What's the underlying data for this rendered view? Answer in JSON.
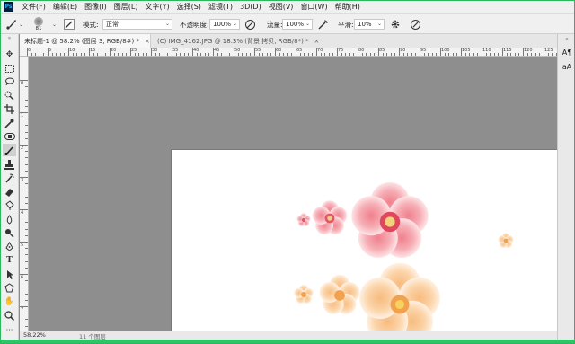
{
  "app": {
    "logo": "Ps"
  },
  "menu": [
    "文件(F)",
    "编辑(E)",
    "图像(I)",
    "图层(L)",
    "文字(Y)",
    "选择(S)",
    "滤镜(T)",
    "3D(D)",
    "视图(V)",
    "窗口(W)",
    "帮助(H)"
  ],
  "options": {
    "brush_size": "81",
    "mode_label": "模式:",
    "mode_value": "正常",
    "opacity_label": "不透明度:",
    "opacity_value": "100%",
    "flow_label": "流量:",
    "flow_value": "100%",
    "smooth_label": "平滑:",
    "smooth_value": "10%"
  },
  "tabs": [
    {
      "label": "未标题-1 @ 58.2% (图层 3, RGB/8#) *",
      "close": "×"
    },
    {
      "label": "(C) IMG_4162.JPG @ 18.3% (背景 拷贝, RGB/8*) *",
      "close": "×"
    }
  ],
  "ruler_h": [
    "0",
    "5",
    "10",
    "15",
    "20",
    "25",
    "30",
    "35",
    "40",
    "45",
    "50",
    "55",
    "60",
    "65",
    "70",
    "75",
    "80",
    "85",
    "90",
    "95",
    "100",
    "105",
    "110",
    "115",
    "120",
    "125"
  ],
  "ruler_v": [
    "0",
    "1",
    "2",
    "3",
    "4",
    "5",
    "6",
    "7",
    "8"
  ],
  "status": {
    "zoom": "58.22%",
    "info": "11 个图层"
  },
  "colors": {
    "accent": "#2fc46a",
    "canvas": "#ffffff",
    "workspace": "#8e8e8e",
    "pink_petal": "#f4a3ab",
    "peach_petal": "#fbd2a4"
  },
  "tools": [
    "move-icon",
    "marquee-icon",
    "lasso-icon",
    "quick-select-icon",
    "crop-icon",
    "eyedropper-icon",
    "healing-icon",
    "brush-icon",
    "stamp-icon",
    "history-brush-icon",
    "eraser-icon",
    "gradient-icon",
    "blur-icon",
    "dodge-icon",
    "pen-icon",
    "type-icon",
    "path-select-icon",
    "shape-icon",
    "hand-icon",
    "zoom-icon"
  ]
}
